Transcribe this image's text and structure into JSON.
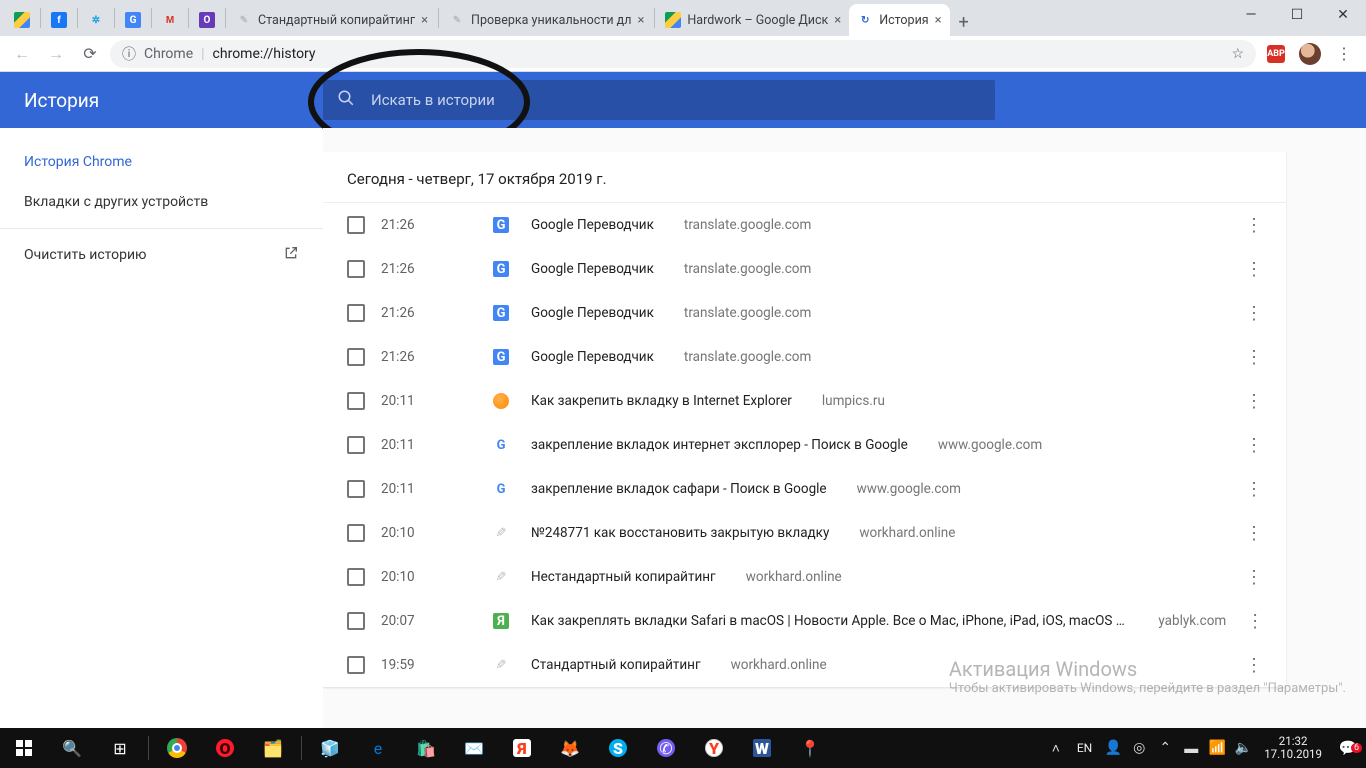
{
  "browser": {
    "pinned_tabs": [
      {
        "name": "drive",
        "cls": "ico-drive",
        "glyph": ""
      },
      {
        "name": "facebook",
        "cls": "ico-fb",
        "glyph": "f"
      },
      {
        "name": "gear",
        "cls": "ico-gear",
        "glyph": "✲"
      },
      {
        "name": "translate",
        "cls": "ico-gt",
        "glyph": "G"
      },
      {
        "name": "gmail",
        "cls": "ico-gm",
        "glyph": "M"
      },
      {
        "name": "purple",
        "cls": "ico-pu",
        "glyph": "O"
      }
    ],
    "tabs": [
      {
        "title": "Стандартный копирайтинг",
        "icon_cls": "ico-wh",
        "icon_glyph": "✎",
        "active": false,
        "close": true
      },
      {
        "title": "Проверка уникальности дл",
        "icon_cls": "ico-wh",
        "icon_glyph": "✎",
        "active": false,
        "close": true
      },
      {
        "title": "Hardwork – Google Диск",
        "icon_cls": "ico-drive",
        "icon_glyph": "",
        "active": false,
        "close": true
      },
      {
        "title": "История",
        "icon_cls": "ico-hist",
        "icon_glyph": "↻",
        "active": true,
        "close": true
      }
    ],
    "omnibox_chip": "Chrome",
    "omnibox_url": "chrome://history",
    "adblock": "ABP"
  },
  "history": {
    "title": "История",
    "search_placeholder": "Искать в истории",
    "side": {
      "chrome": "История Chrome",
      "devices": "Вкладки с других устройств",
      "clear": "Очистить историю"
    },
    "day_header": "Сегодня - четверг, 17 октября 2019 г.",
    "rows": [
      {
        "time": "21:26",
        "fav": "gt",
        "title": "Google Переводчик",
        "domain": "translate.google.com"
      },
      {
        "time": "21:26",
        "fav": "gt",
        "title": "Google Переводчик",
        "domain": "translate.google.com"
      },
      {
        "time": "21:26",
        "fav": "gt",
        "title": "Google Переводчик",
        "domain": "translate.google.com"
      },
      {
        "time": "21:26",
        "fav": "gt",
        "title": "Google Переводчик",
        "domain": "translate.google.com"
      },
      {
        "time": "20:11",
        "fav": "orange",
        "title": "Как закрепить вкладку в Internet Explorer",
        "domain": "lumpics.ru"
      },
      {
        "time": "20:11",
        "fav": "google",
        "title": "закрепление вкладок интернет эксплорер - Поиск в Google",
        "domain": "www.google.com"
      },
      {
        "time": "20:11",
        "fav": "google",
        "title": "закрепление вкладок сафари - Поиск в Google",
        "domain": "www.google.com"
      },
      {
        "time": "20:10",
        "fav": "wh",
        "title": "№248771 как восстановить закрытую вкладку",
        "domain": "workhard.online"
      },
      {
        "time": "20:10",
        "fav": "wh",
        "title": "Нестандартный копирайтинг",
        "domain": "workhard.online"
      },
      {
        "time": "20:07",
        "fav": "ya",
        "title": "Как закреплять вкладки Safari в macOS | Новости Apple. Все о Mac, iPhone, iPad, iOS, macOS и Apple TV",
        "domain": "yablyk.com"
      },
      {
        "time": "19:59",
        "fav": "wh",
        "title": "Стандартный копирайтинг",
        "domain": "workhard.online"
      }
    ]
  },
  "watermark": {
    "line1": "Активация Windows",
    "line2": "Чтобы активировать Windows, перейдите в раздел \"Параметры\"."
  },
  "taskbar": {
    "lang": "EN",
    "time": "21:32",
    "date": "17.10.2019",
    "notif_count": "6"
  }
}
